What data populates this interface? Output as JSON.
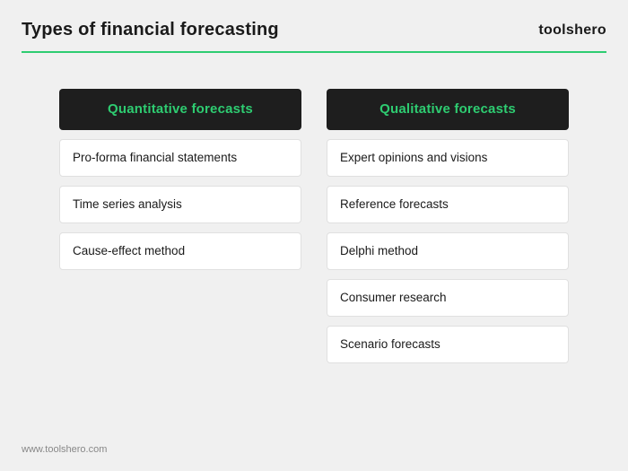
{
  "header": {
    "title": "Types of financial forecasting",
    "brand": "toolshero"
  },
  "columns": [
    {
      "id": "quantitative",
      "header": "Quantitative forecasts",
      "items": [
        "Pro-forma financial statements",
        "Time series analysis",
        "Cause-effect method"
      ]
    },
    {
      "id": "qualitative",
      "header": "Qualitative forecasts",
      "items": [
        "Expert opinions and visions",
        "Reference forecasts",
        "Delphi method",
        "Consumer research",
        "Scenario forecasts"
      ]
    }
  ],
  "footer": {
    "url": "www.toolshero.com"
  }
}
